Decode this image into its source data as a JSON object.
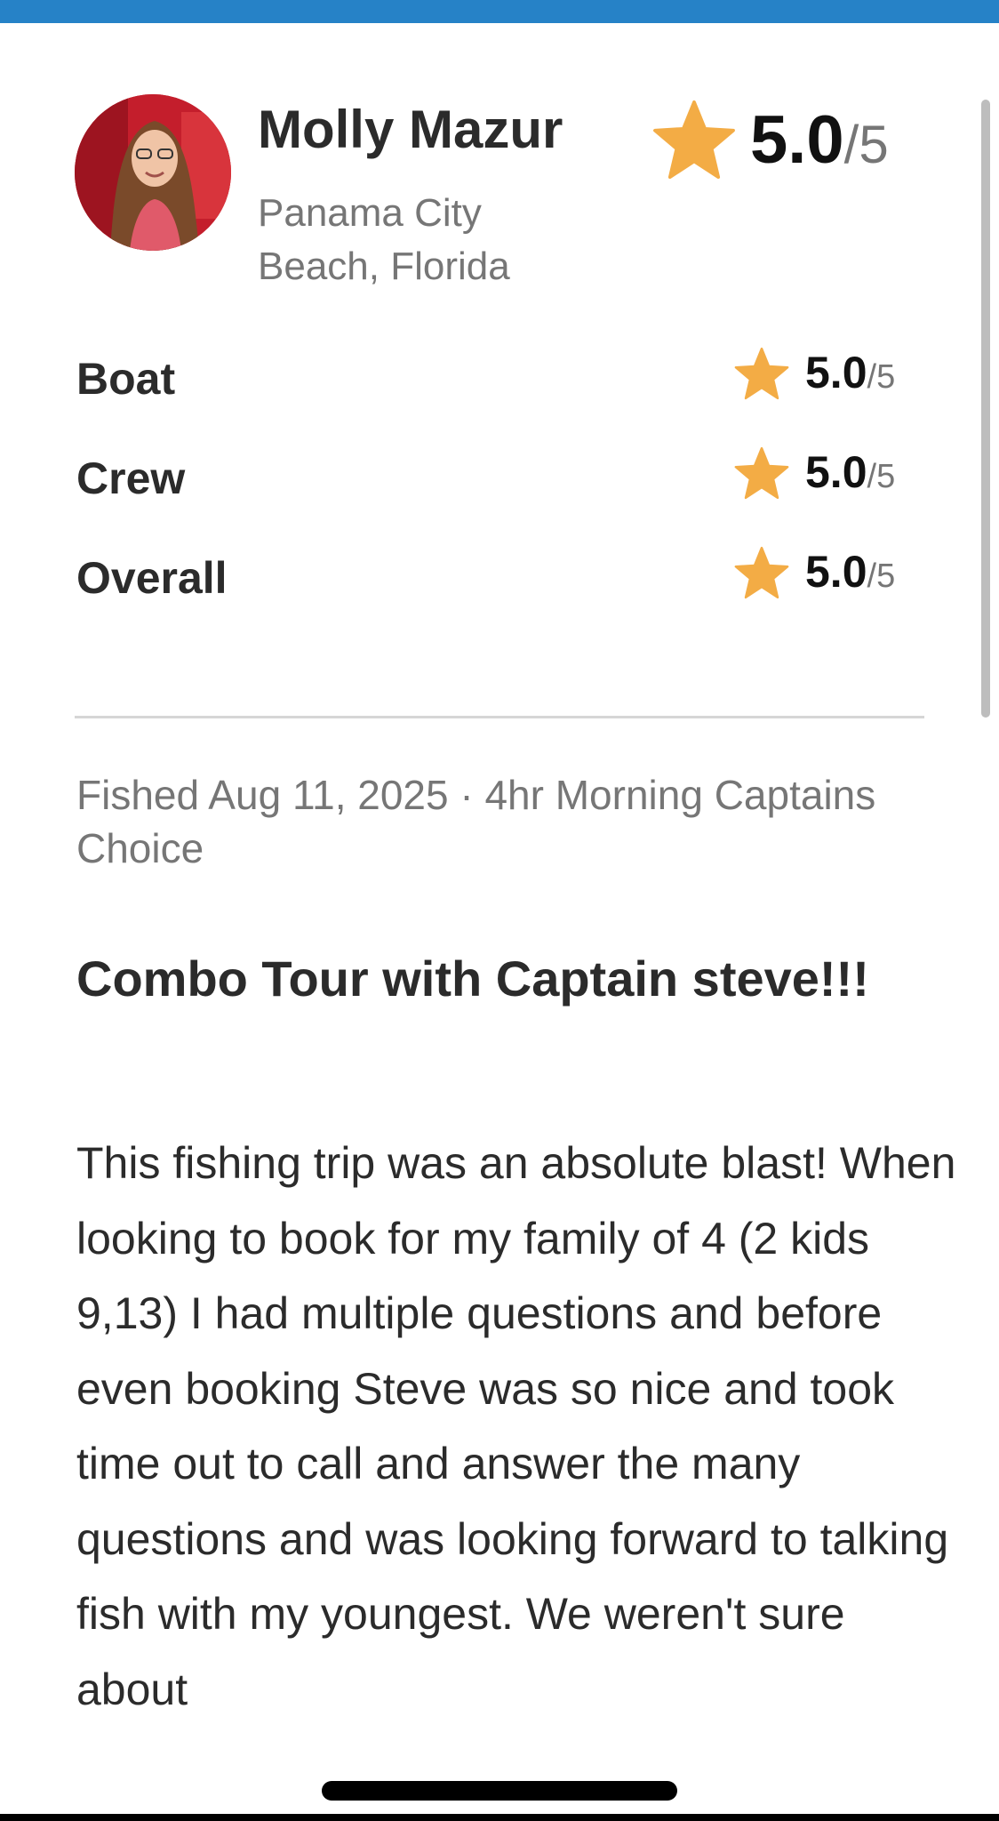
{
  "review": {
    "reviewer_name": "Molly Mazur",
    "reviewer_location": "Panama City Beach, Florida",
    "overall_rating": "5.0",
    "rating_scale": "/5",
    "overall_rating_value": 5.0,
    "categories": [
      {
        "label": "Boat",
        "rating": "5.0",
        "scale": "/5"
      },
      {
        "label": "Crew",
        "rating": "5.0",
        "scale": "/5"
      },
      {
        "label": "Overall",
        "rating": "5.0",
        "scale": "/5"
      }
    ],
    "trip_meta": "Fished Aug 11, 2025 · 4hr Morning Captains Choice",
    "title": "Combo Tour with Captain steve!!!",
    "body": "This fishing trip was an absolute blast! When looking to book for my family of 4 (2 kids 9,13) I had multiple questions and before even booking Steve was so nice and took time out to call and answer the many questions and was looking forward to talking fish with my youngest. We weren't sure about"
  },
  "icons": {
    "rating": "star-icon",
    "avatar": "reviewer-photo"
  },
  "colors": {
    "top_bar": "#2682c7",
    "star": "#f3ac45",
    "text": "#2b2b2b",
    "muted_text": "#767676",
    "divider": "#d6d6d6"
  }
}
